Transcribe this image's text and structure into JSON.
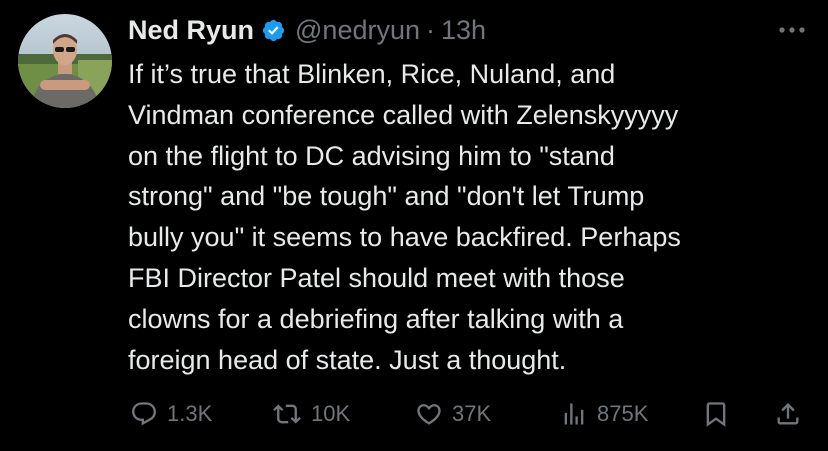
{
  "tweet": {
    "display_name": "Ned Ryun",
    "handle": "@nedryun",
    "separator": "·",
    "time": "13h",
    "verified": true,
    "avatar_icon": "profile-photo",
    "more_icon": "more-horizontal-icon",
    "text_lines": [
      "If it’s true that Blinken, Rice, Nuland, and",
      "Vindman conference called with Zelenskyyyyy",
      "on the flight to DC advising him to \"stand",
      "strong\" and \"be tough\" and \"don't let Trump",
      "bully you\" it seems to have backfired. Perhaps",
      "FBI Director Patel should meet with those",
      "clowns for a debriefing after talking with a",
      "foreign head of state. Just a thought."
    ]
  },
  "actions": {
    "replies": "1.3K",
    "reposts": "10K",
    "likes": "37K",
    "views": "875K"
  },
  "colors": {
    "background": "#000000",
    "text": "#e7e9ea",
    "secondary": "#71767b",
    "verified": "#1d9bf0"
  }
}
